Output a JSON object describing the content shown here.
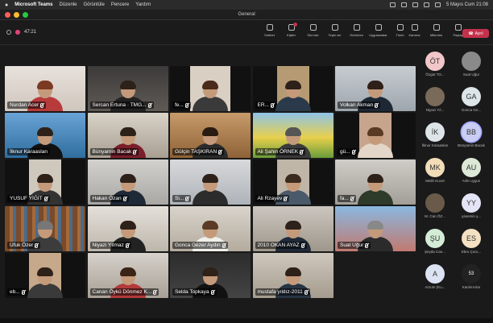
{
  "menubar": {
    "apple": "",
    "app_name": "Microsoft Teams",
    "items": [
      "Düzenle",
      "Görüntüle",
      "Pencere",
      "Yardım"
    ],
    "date_time": "5 Mayıs Cum 21:08"
  },
  "window": {
    "title": "General"
  },
  "call": {
    "duration": "47:21"
  },
  "toolbar": {
    "items": [
      {
        "label": "Sohbet",
        "icon": "chat-icon"
      },
      {
        "label": "Kişiler",
        "icon": "people-icon"
      },
      {
        "label": "Söz iste",
        "icon": "raise-hand-icon"
      },
      {
        "label": "Tepki ver",
        "icon": "react-icon"
      },
      {
        "label": "Görünüm",
        "icon": "view-icon"
      },
      {
        "label": "Uygulamalar",
        "icon": "apps-icon"
      },
      {
        "label": "Tümü",
        "icon": "more-icon"
      }
    ],
    "right_items": [
      {
        "label": "Kamera",
        "icon": "camera-icon"
      },
      {
        "label": "Mikrofon",
        "icon": "mic-icon"
      },
      {
        "label": "Paylaş",
        "icon": "share-icon"
      }
    ],
    "leave_label": "Ayrıl"
  },
  "participants": [
    {
      "name": "Nurdan Acer"
    },
    {
      "name": "Sercan Ertuna · TMG..."
    },
    {
      "name": "fe..."
    },
    {
      "name": "ER..."
    },
    {
      "name": "Volkan Akman"
    },
    {
      "name": "İlknur Karaaslan"
    },
    {
      "name": "Bünyamin Bacak"
    },
    {
      "name": "Gülçin TAŞKIRAN"
    },
    {
      "name": "Ali Şahin ÖRNEK"
    },
    {
      "name": "gü..."
    },
    {
      "name": "YUSUF YİĞİT"
    },
    {
      "name": "Hakan Özan"
    },
    {
      "name": "Si..."
    },
    {
      "name": "Ali Rzayev"
    },
    {
      "name": "fa..."
    },
    {
      "name": "Ufuk Özer"
    },
    {
      "name": "Niyazi Yılmaz"
    },
    {
      "name": "Gonca Gezer Aydın"
    },
    {
      "name": "2010 OKAN AYAZ"
    },
    {
      "name": "Suat Uğur"
    },
    {
      "name": "eb..."
    },
    {
      "name": "Canan Öykü Dönmez K..."
    },
    {
      "name": "Selda Topkaya"
    },
    {
      "name": "mustafa yıldız-2011"
    }
  ],
  "roster": [
    {
      "initials": "ÖT",
      "name": "Özgür TO...",
      "color": "#f2c7c9"
    },
    {
      "initials": "",
      "name": "Suat Uğur",
      "color": "#8a8a8a"
    },
    {
      "initials": "",
      "name": "Niyazi Yıl...",
      "color": "#7a6a5a"
    },
    {
      "initials": "GA",
      "name": "Gonca Ge...",
      "color": "#dde5e8"
    },
    {
      "initials": "İK",
      "name": "İlknur Karaaslan",
      "color": "#dde5e8"
    },
    {
      "initials": "BB",
      "name": "Bünyamin Bacak",
      "color": "#c9cdf3"
    },
    {
      "initials": "MK",
      "name": "Melih Kucet",
      "color": "#f3ddb8"
    },
    {
      "initials": "AU",
      "name": "Arife uygun",
      "color": "#dde9d6"
    },
    {
      "initials": "",
      "name": "M. Can ÖZ...",
      "color": "#6a5a4a"
    },
    {
      "initials": "YY",
      "name": "yasemin y...",
      "color": "#e3e4f5"
    },
    {
      "initials": "ŞU",
      "name": "Şeyda Can...",
      "color": "#d4ecd6"
    },
    {
      "initials": "ES",
      "name": "Ebru Çuru...",
      "color": "#f4e1c3"
    },
    {
      "initials": "A",
      "name": "Arzum (Ku...",
      "color": "#dce4f3"
    },
    {
      "initials": "53",
      "name": "Katılımcılar",
      "color": "#222222"
    }
  ]
}
